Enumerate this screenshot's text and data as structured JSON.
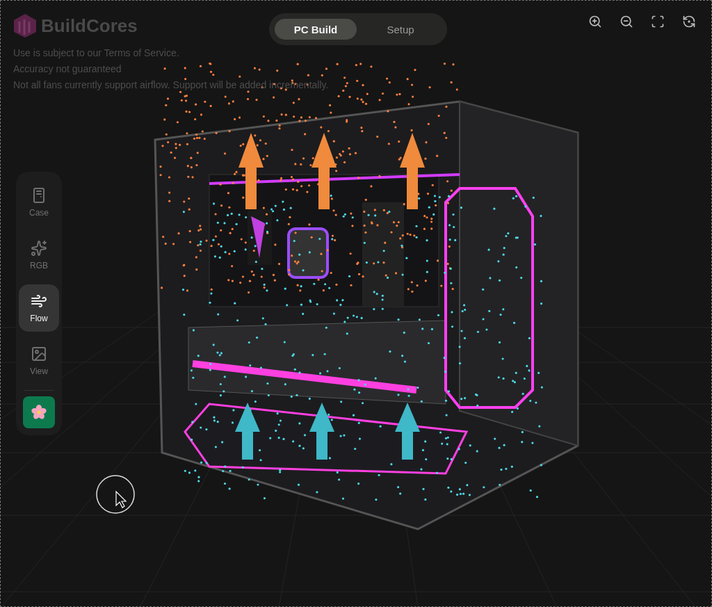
{
  "brand": {
    "name": "BuildCores"
  },
  "notices": [
    "Use is subject to our Terms of Service.",
    "Accuracy not guaranteed",
    "Not all fans currently support airflow. Support will be added incrementally."
  ],
  "mode_tabs": [
    {
      "label": "PC Build",
      "selected": true
    },
    {
      "label": "Setup",
      "selected": false
    }
  ],
  "toolbar": [
    {
      "kind": "zoom-in"
    },
    {
      "kind": "zoom-out"
    },
    {
      "kind": "fit"
    },
    {
      "kind": "reset"
    }
  ],
  "sidebar": {
    "items": [
      {
        "kind": "case",
        "label": "Case",
        "selected": false
      },
      {
        "kind": "rgb",
        "label": "RGB",
        "selected": false
      },
      {
        "kind": "flow",
        "label": "Flow",
        "selected": true
      },
      {
        "kind": "view",
        "label": "View",
        "selected": false
      }
    ],
    "action": {
      "kind": "flower"
    }
  }
}
